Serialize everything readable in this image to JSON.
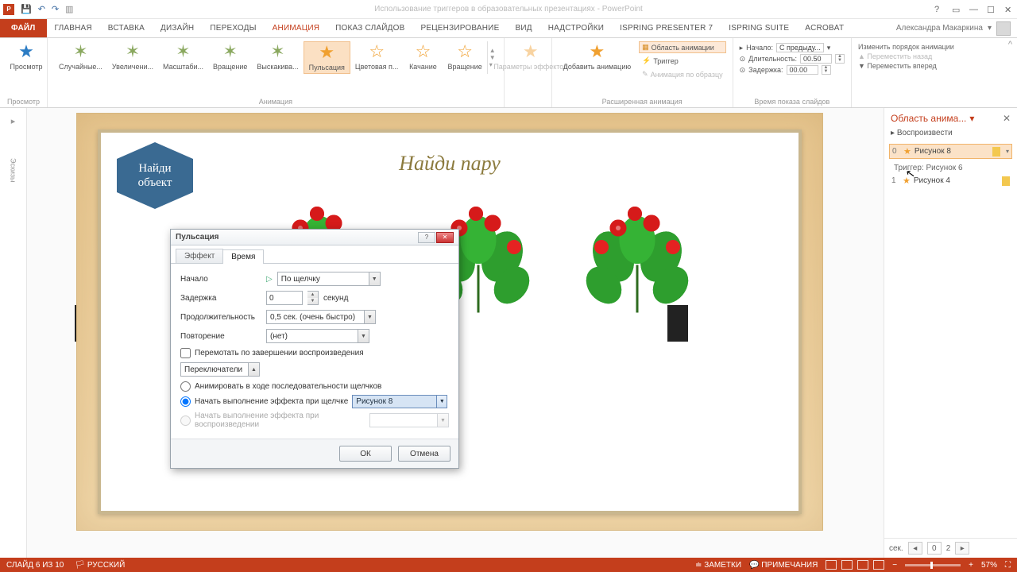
{
  "window_title": "Использование триггеров в образовательных презентациях - PowerPoint",
  "user_name": "Александра Макаркина",
  "tabs": {
    "file": "ФАЙЛ",
    "home": "ГЛАВНАЯ",
    "insert": "ВСТАВКА",
    "design": "ДИЗАЙН",
    "transitions": "ПЕРЕХОДЫ",
    "animations": "АНИМАЦИЯ",
    "slideshow": "ПОКАЗ СЛАЙДОВ",
    "review": "РЕЦЕНЗИРОВАНИЕ",
    "view": "ВИД",
    "addins": "НАДСТРОЙКИ",
    "ispring": "ISPRING PRESENTER 7",
    "isuite": "iSpring Suite",
    "acrobat": "ACROBAT"
  },
  "ribbon": {
    "preview_label": "Просмотр",
    "preview_group": "Просмотр",
    "gallery": {
      "random": "Случайные...",
      "grow": "Увеличени...",
      "spin_scale": "Масштаби...",
      "spin": "Вращение",
      "bounce": "Выскакива...",
      "pulse": "Пульсация",
      "color": "Цветовая п...",
      "teeter": "Качание",
      "spin2": "Вращение"
    },
    "animation_group": "Анимация",
    "effect_options": "Параметры эффектов",
    "add_animation": "Добавить анимацию",
    "adv": {
      "pane": "Область анимации",
      "trigger": "Триггер",
      "painter": "Анимация по образцу"
    },
    "adv_group": "Расширенная анимация",
    "timing": {
      "start_label": "Начало:",
      "start_value": "С предыду...",
      "duration_label": "Длительность:",
      "duration_value": "00.50",
      "delay_label": "Задержка:",
      "delay_value": "00.00"
    },
    "reorder": {
      "title": "Изменить порядок анимации",
      "back": "Переместить назад",
      "forward": "Переместить вперед"
    },
    "timing_group": "Время показа слайдов"
  },
  "slide": {
    "hex_line1": "Найди",
    "hex_line2": "объект",
    "title": "Найди пару"
  },
  "thumbstrip": {
    "label": "Эскизы"
  },
  "dialog": {
    "title": "Пульсация",
    "tab_effect": "Эффект",
    "tab_timing": "Время",
    "start_label": "Начало",
    "start_value": "По щелчку",
    "delay_label": "Задержка",
    "delay_value": "0",
    "delay_unit": "секунд",
    "duration_label": "Продолжительность",
    "duration_value": "0,5 сек. (очень быстро)",
    "repeat_label": "Повторение",
    "repeat_value": "(нет)",
    "rewind_label": "Перемотать по завершении воспроизведения",
    "triggers_btn": "Переключатели",
    "opt_sequence": "Анимировать в ходе последовательности щелчков",
    "opt_onclick": "Начать выполнение эффекта при щелчке",
    "trigger_target": "Рисунок 8",
    "opt_onplay": "Начать выполнение эффекта при воспроизведении",
    "ok": "ОК",
    "cancel": "Отмена"
  },
  "anim_pane": {
    "title": "Область анима...",
    "play": "Воспроизвести",
    "item1": "Рисунок 8",
    "trigger_header": "Триггер: Рисунок 6",
    "item2": "Рисунок 4",
    "sec_label": "сек.",
    "page_current": "0",
    "page_total": "2"
  },
  "status": {
    "slide_info": "СЛАЙД 6 ИЗ 10",
    "lang": "РУССКИЙ",
    "notes": "ЗАМЕТКИ",
    "comments": "ПРИМЕЧАНИЯ",
    "zoom": "57%"
  }
}
